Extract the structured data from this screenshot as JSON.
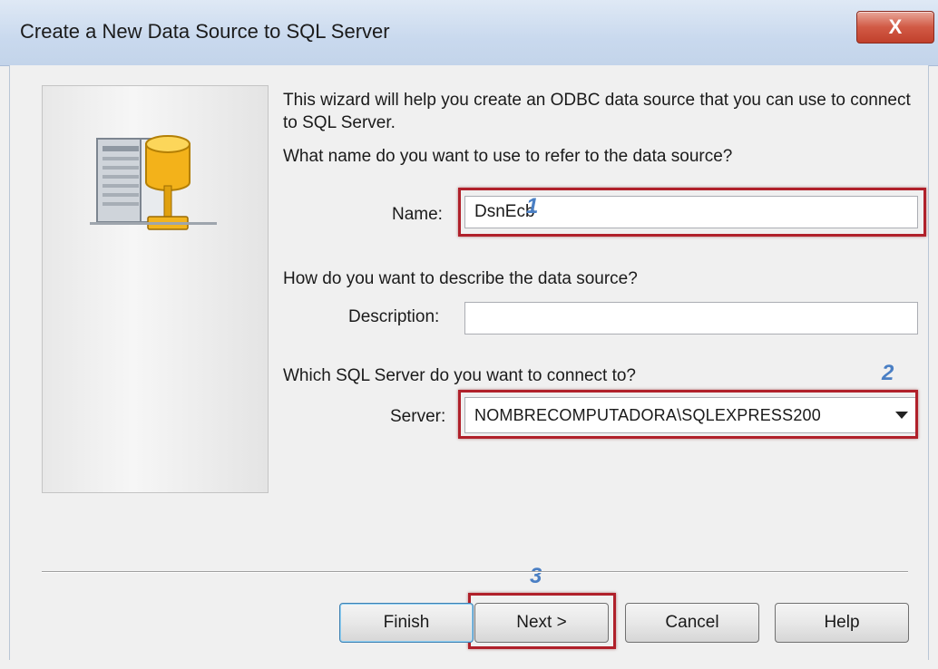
{
  "window": {
    "title": "Create a New Data Source to SQL Server",
    "close_glyph": "X"
  },
  "content": {
    "intro": "This wizard will help you create an ODBC data source that you can use to connect to SQL Server.",
    "name_question": "What name do you want to use to refer to the data source?",
    "name_label": "Name:",
    "name_value": "DsnEcb",
    "description_question": "How do you want to describe the data source?",
    "description_label": "Description:",
    "description_value": "",
    "server_question": "Which SQL Server do you want to connect to?",
    "server_label": "Server:",
    "server_value": "NOMBRECOMPUTADORA\\SQLEXPRESS200"
  },
  "annotations": {
    "step1": "1",
    "step2": "2",
    "step3": "3",
    "highlight_color": "#b0202a",
    "number_color": "#4a7fc4"
  },
  "buttons": {
    "finish": "Finish",
    "next": "Next >",
    "cancel": "Cancel",
    "help": "Help"
  },
  "icons": {
    "wizard_art": "database-server-icon",
    "dropdown": "chevron-down-icon",
    "close": "close-icon"
  }
}
